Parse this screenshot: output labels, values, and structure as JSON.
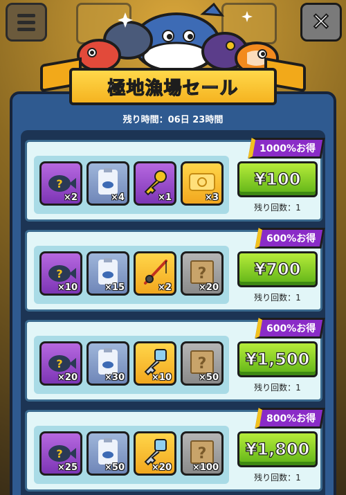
{
  "title": "極地漁場セール",
  "timer": "残り時間：06日 23時間",
  "offers": [
    {
      "badge": "1000%お得",
      "price": "¥100",
      "remaining": "残り回数：1",
      "items": [
        {
          "icon": "mystery-fish-icon",
          "qty": "×2"
        },
        {
          "icon": "fish-bag-icon",
          "qty": "×4"
        },
        {
          "icon": "gold-key-icon",
          "qty": "×1"
        },
        {
          "icon": "gold-ticket-icon",
          "qty": "×3"
        }
      ]
    },
    {
      "badge": "600%お得",
      "price": "¥700",
      "remaining": "残り回数：1",
      "items": [
        {
          "icon": "mystery-fish-icon",
          "qty": "×10"
        },
        {
          "icon": "fish-bag-icon",
          "qty": "×15"
        },
        {
          "icon": "fishing-rod-icon",
          "qty": "×2"
        },
        {
          "icon": "mystery-box-icon",
          "qty": "×20"
        }
      ]
    },
    {
      "badge": "600%お得",
      "price": "¥1,500",
      "remaining": "残り回数：1",
      "items": [
        {
          "icon": "mystery-fish-icon",
          "qty": "×20"
        },
        {
          "icon": "fish-bag-icon",
          "qty": "×30"
        },
        {
          "icon": "silver-key-icon",
          "qty": "×10"
        },
        {
          "icon": "mystery-box-icon",
          "qty": "×50"
        }
      ]
    },
    {
      "badge": "800%お得",
      "price": "¥1,800",
      "remaining": "残り回数：1",
      "items": [
        {
          "icon": "mystery-fish-icon",
          "qty": "×25"
        },
        {
          "icon": "fish-bag-icon",
          "qty": "×50"
        },
        {
          "icon": "silver-key-icon",
          "qty": "×20"
        },
        {
          "icon": "mystery-box-icon",
          "qty": "×100"
        }
      ]
    }
  ],
  "colors": {
    "panel": "#2f5a90",
    "ribbon": "#f5b320",
    "badge": "#8a2cc7",
    "buy_button": "#7cc824"
  }
}
